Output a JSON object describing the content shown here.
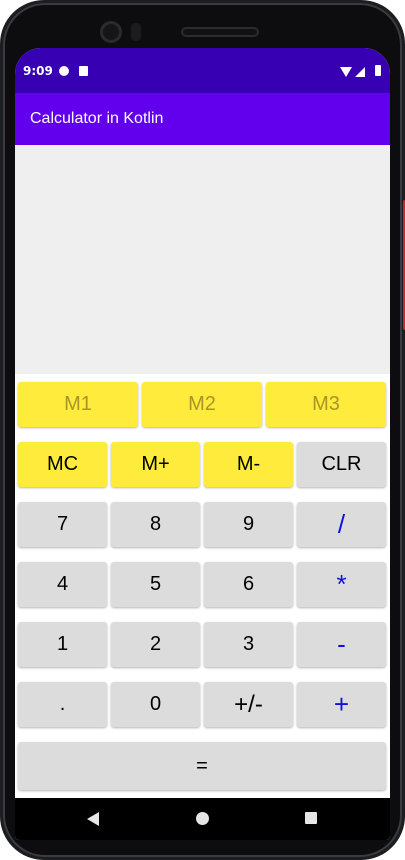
{
  "status_bar": {
    "time": "9:09",
    "icons": [
      "notification-icon",
      "sd-card-icon",
      "wifi-icon",
      "signal-icon",
      "battery-icon"
    ],
    "background": "#3700b3"
  },
  "app_bar": {
    "title": "Calculator in Kotlin",
    "background": "#6200ee"
  },
  "display": {
    "value": ""
  },
  "memory_slots": [
    "M1",
    "M2",
    "M3"
  ],
  "memory_ops": [
    "MC",
    "M+",
    "M-"
  ],
  "clear_label": "CLR",
  "keypad": {
    "row1": [
      "7",
      "8",
      "9",
      "/"
    ],
    "row2": [
      "4",
      "5",
      "6",
      "*"
    ],
    "row3": [
      "1",
      "2",
      "3",
      "-"
    ],
    "row4": [
      ".",
      "0",
      "+/-",
      "+"
    ]
  },
  "equals_label": "=",
  "colors": {
    "key_gray": "#dcdcdc",
    "key_yellow": "#ffeb3b",
    "operator_blue": "#1010e0",
    "memory_slot_text": "#a8952a"
  },
  "nav_bar": {
    "icons": [
      "back-icon",
      "home-icon",
      "recents-icon"
    ]
  }
}
